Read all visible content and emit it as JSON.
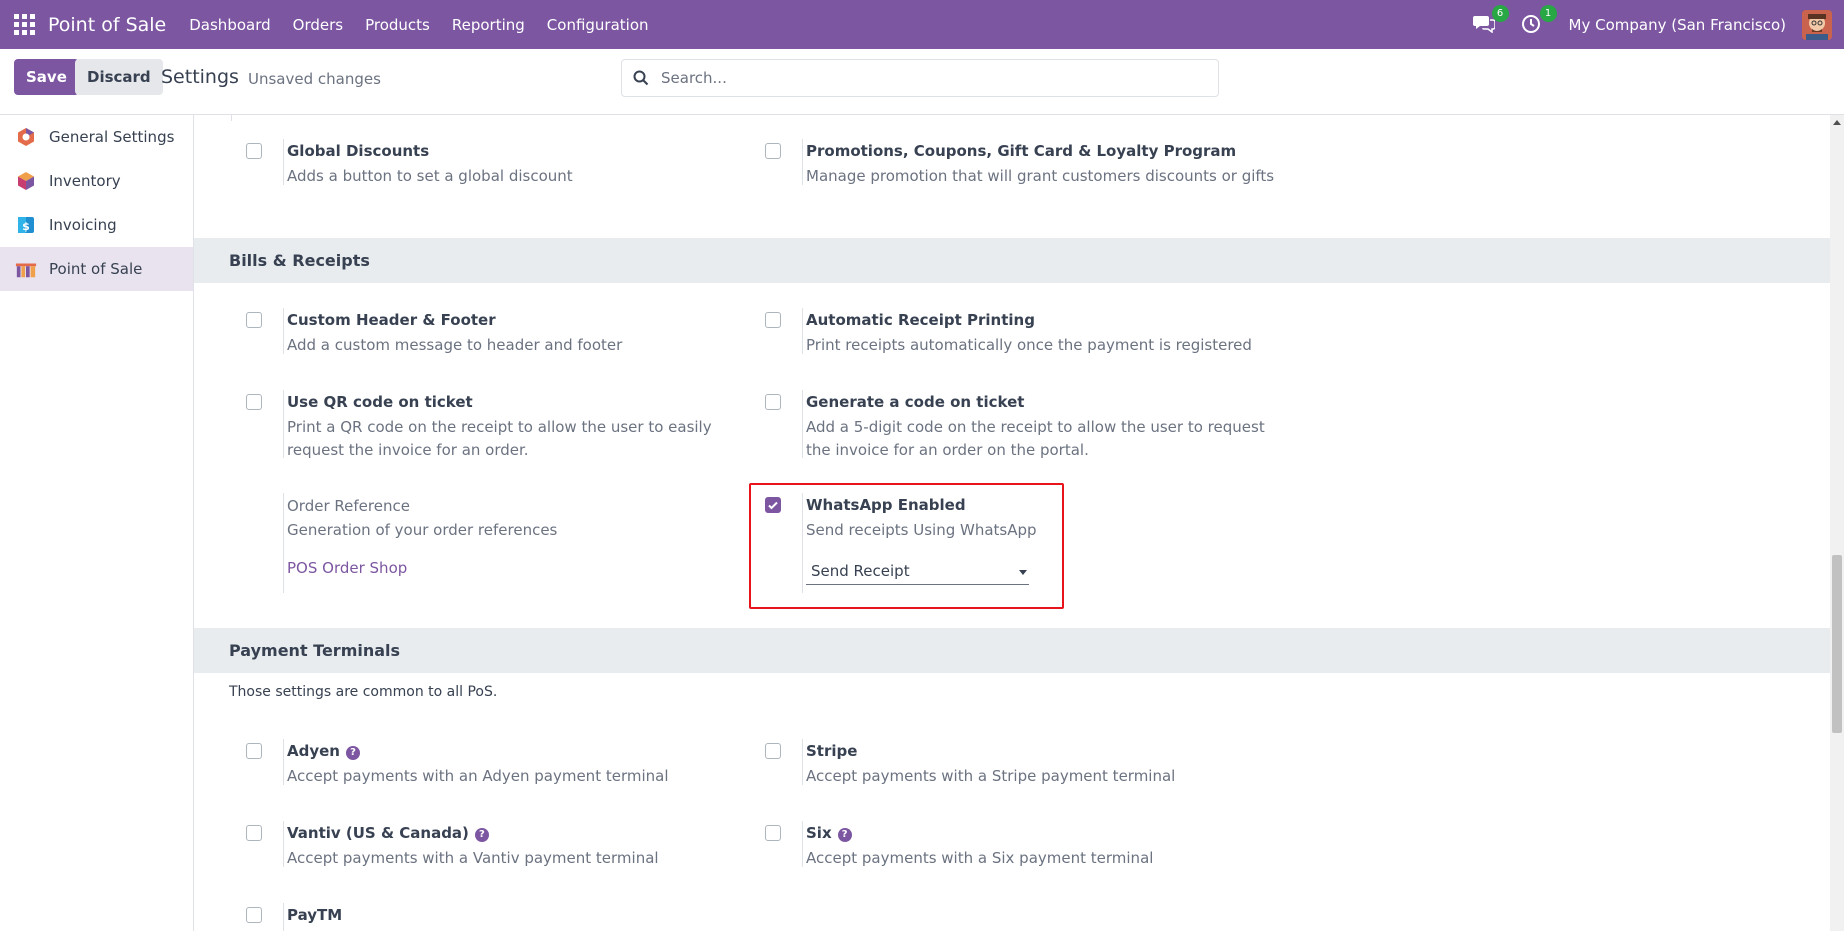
{
  "navbar": {
    "brand": "Point of Sale",
    "menu": [
      "Dashboard",
      "Orders",
      "Products",
      "Reporting",
      "Configuration"
    ],
    "messages_count": "6",
    "activities_count": "1",
    "company": "My Company (San Francisco)",
    "color": "#7c56a1"
  },
  "control": {
    "save_label": "Save",
    "discard_label": "Discard",
    "title": "Settings",
    "status": "Unsaved changes",
    "search_placeholder": "Search..."
  },
  "sidebar": {
    "items": [
      {
        "label": "General Settings",
        "icon": "general-settings-icon"
      },
      {
        "label": "Inventory",
        "icon": "inventory-icon"
      },
      {
        "label": "Invoicing",
        "icon": "invoicing-icon"
      },
      {
        "label": "Point of Sale",
        "icon": "point-of-sale-icon",
        "active": true
      }
    ]
  },
  "discounts": {
    "global": {
      "title": "Global Discounts",
      "desc": "Adds a button to set a global discount",
      "checked": false
    },
    "promotions": {
      "title": "Promotions, Coupons, Gift Card & Loyalty Program",
      "desc": "Manage promotion that will grant customers discounts or gifts",
      "checked": false
    }
  },
  "bills": {
    "header": "Bills & Receipts",
    "custom_header": {
      "title": "Custom Header & Footer",
      "desc": "Add a custom message to header and footer",
      "checked": false
    },
    "auto_print": {
      "title": "Automatic Receipt Printing",
      "desc": "Print receipts automatically once the payment is registered",
      "checked": false
    },
    "qr_code": {
      "title": "Use QR code on ticket",
      "desc1": "Print a QR code on the receipt to allow the user to easily",
      "desc2": "request the invoice for an order.",
      "checked": false
    },
    "gen_code": {
      "title": "Generate a code on ticket",
      "desc1": "Add a 5-digit code on the receipt to allow the user to request",
      "desc2": "the invoice for an order on the portal.",
      "checked": false
    },
    "order_ref": {
      "title": "Order Reference",
      "desc": "Generation of your order references",
      "link": "POS Order Shop"
    },
    "whatsapp": {
      "title": "WhatsApp Enabled",
      "desc": "Send receipts Using WhatsApp",
      "select_value": "Send Receipt",
      "checked": true
    }
  },
  "payment": {
    "header": "Payment Terminals",
    "note": "Those settings are common to all PoS.",
    "adyen": {
      "title": "Adyen",
      "desc": "Accept payments with an Adyen payment terminal",
      "checked": false
    },
    "stripe": {
      "title": "Stripe",
      "desc": "Accept payments with a Stripe payment terminal",
      "checked": false
    },
    "vantiv": {
      "title": "Vantiv (US & Canada)",
      "desc": "Accept payments with a Vantiv payment terminal",
      "checked": false
    },
    "six": {
      "title": "Six",
      "desc": "Accept payments with a Six payment terminal",
      "checked": false
    },
    "paytm": {
      "title": "PayTM",
      "checked": false
    }
  }
}
